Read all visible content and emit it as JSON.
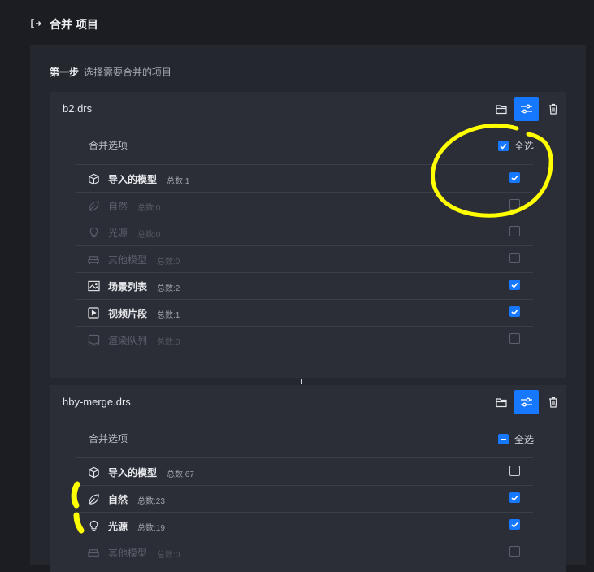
{
  "title": "合并 项目",
  "step": {
    "label": "第一步",
    "desc": "选择需要合并的项目"
  },
  "colors": {
    "accent": "#1677ff",
    "highlight": "#ffff00"
  },
  "cards": [
    {
      "file_name": "b2.drs",
      "options_label": "合并选项",
      "select_all_label": "全选",
      "select_all_state": "checked",
      "items": [
        {
          "icon": "cube-icon",
          "label": "导入的模型",
          "count": "总数:1",
          "checked": true,
          "enabled": true
        },
        {
          "icon": "leaf-icon",
          "label": "自然",
          "count": "总数:0",
          "checked": false,
          "enabled": false
        },
        {
          "icon": "bulb-icon",
          "label": "光源",
          "count": "总数:0",
          "checked": false,
          "enabled": false
        },
        {
          "icon": "sofa-icon",
          "label": "其他模型",
          "count": "总数:0",
          "checked": false,
          "enabled": false
        },
        {
          "icon": "image-icon",
          "label": "场景列表",
          "count": "总数:2",
          "checked": true,
          "enabled": true
        },
        {
          "icon": "video-icon",
          "label": "视频片段",
          "count": "总数:1",
          "checked": true,
          "enabled": true
        },
        {
          "icon": "render-queue-icon",
          "label": "渲染队列",
          "count": "总数:0",
          "checked": false,
          "enabled": false
        }
      ]
    },
    {
      "file_name": "hby-merge.drs",
      "options_label": "合并选项",
      "select_all_label": "全选",
      "select_all_state": "indeterminate",
      "items": [
        {
          "icon": "cube-icon",
          "label": "导入的模型",
          "count": "总数:67",
          "checked": false,
          "enabled": true
        },
        {
          "icon": "leaf-icon",
          "label": "自然",
          "count": "总数:23",
          "checked": true,
          "enabled": true
        },
        {
          "icon": "bulb-icon",
          "label": "光源",
          "count": "总数:19",
          "checked": true,
          "enabled": true
        },
        {
          "icon": "sofa-icon",
          "label": "其他模型",
          "count": "总数:0",
          "checked": false,
          "enabled": false
        }
      ]
    }
  ]
}
